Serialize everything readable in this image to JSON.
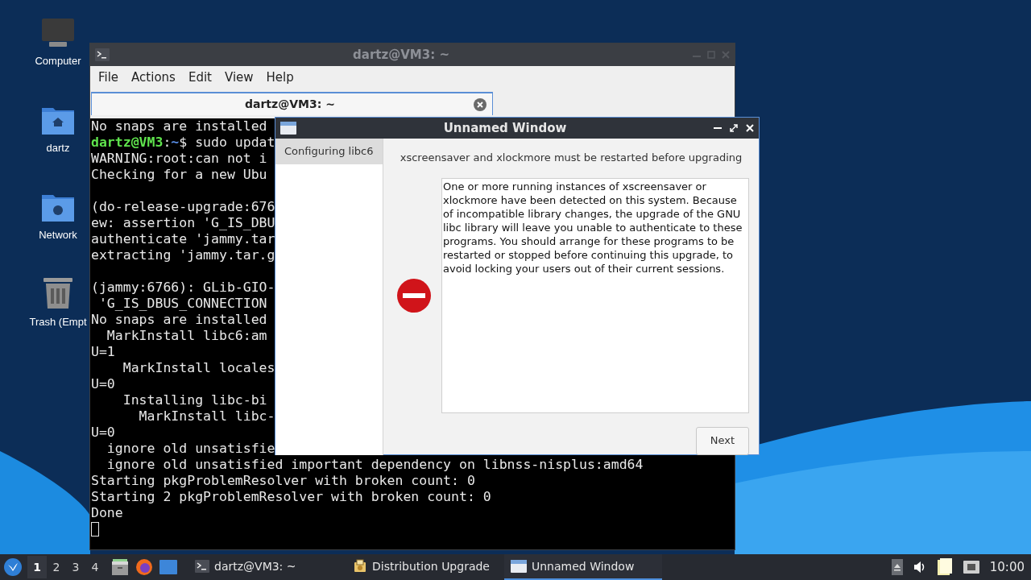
{
  "desktop_icons": [
    {
      "label": "Computer",
      "kind": "computer"
    },
    {
      "label": "dartz",
      "kind": "home"
    },
    {
      "label": "Network",
      "kind": "network"
    },
    {
      "label": "Trash (Empt",
      "kind": "trash"
    }
  ],
  "terminal_window": {
    "title": "dartz@VM3: ~",
    "menu": [
      "File",
      "Actions",
      "Edit",
      "View",
      "Help"
    ],
    "tab": {
      "label": "dartz@VM3: ~"
    },
    "lines": [
      {
        "kind": "text",
        "text": "No snaps are installed"
      },
      {
        "kind": "prompt",
        "user": "dartz@VM3",
        "sep": ":",
        "path": "~",
        "text": "$ sudo updat"
      },
      {
        "kind": "text",
        "text": "WARNING:root:can not i"
      },
      {
        "kind": "text",
        "text": "Checking for a new Ubu"
      },
      {
        "kind": "blank"
      },
      {
        "kind": "text",
        "text": "(do-release-upgrade:676"
      },
      {
        "kind": "text",
        "text": "ew: assertion 'G_IS_DBU"
      },
      {
        "kind": "text",
        "text": "authenticate 'jammy.tar"
      },
      {
        "kind": "text",
        "text": "extracting 'jammy.tar.g"
      },
      {
        "kind": "blank"
      },
      {
        "kind": "text",
        "text": "(jammy:6766): GLib-GIO-"
      },
      {
        "kind": "text",
        "text": " 'G_IS_DBUS_CONNECTION"
      },
      {
        "kind": "text",
        "text": "No snaps are installed"
      },
      {
        "kind": "text",
        "text": "  MarkInstall libc6:am"
      },
      {
        "kind": "text",
        "text": "U=1"
      },
      {
        "kind": "text",
        "text": "    MarkInstall locales"
      },
      {
        "kind": "text",
        "text": "U=0"
      },
      {
        "kind": "text",
        "text": "    Installing libc-bi"
      },
      {
        "kind": "text",
        "text": "      MarkInstall libc-"
      },
      {
        "kind": "text",
        "text": "U=0"
      },
      {
        "kind": "text",
        "text": "  ignore old unsatisfie"
      },
      {
        "kind": "text",
        "text": "  ignore old unsatisfied important dependency on libnss-nisplus:amd64"
      },
      {
        "kind": "text",
        "text": "Starting pkgProblemResolver with broken count: 0"
      },
      {
        "kind": "text",
        "text": "Starting 2 pkgProblemResolver with broken count: 0"
      },
      {
        "kind": "text",
        "text": "Done"
      },
      {
        "kind": "cursor"
      }
    ]
  },
  "dialog": {
    "title": "Unnamed Window",
    "steps": [
      {
        "label": "Configuring libc6",
        "selected": true
      }
    ],
    "heading": "xscreensaver and xlockmore must be restarted before upgrading",
    "message": "One or more running instances of xscreensaver or xlockmore have been detected on this system. Because of incompatible library changes, the upgrade of the GNU libc library will leave you unable to authenticate to these programs. You should arrange for these programs to be restarted or stopped before continuing this upgrade, to avoid locking your users out of their current sessions.",
    "buttons": [
      "Next"
    ]
  },
  "taskbar": {
    "workspaces": [
      {
        "label": "1",
        "selected": true
      },
      {
        "label": "2",
        "selected": false
      },
      {
        "label": "3",
        "selected": false
      },
      {
        "label": "4",
        "selected": false
      }
    ],
    "tasks": [
      {
        "label": "dartz@VM3: ~",
        "kind": "terminal",
        "selected": false
      },
      {
        "label": "Distribution Upgrade",
        "kind": "upgrade",
        "selected": false
      },
      {
        "label": "Unnamed Window",
        "kind": "window",
        "selected": true
      }
    ],
    "clock": "10:00"
  }
}
